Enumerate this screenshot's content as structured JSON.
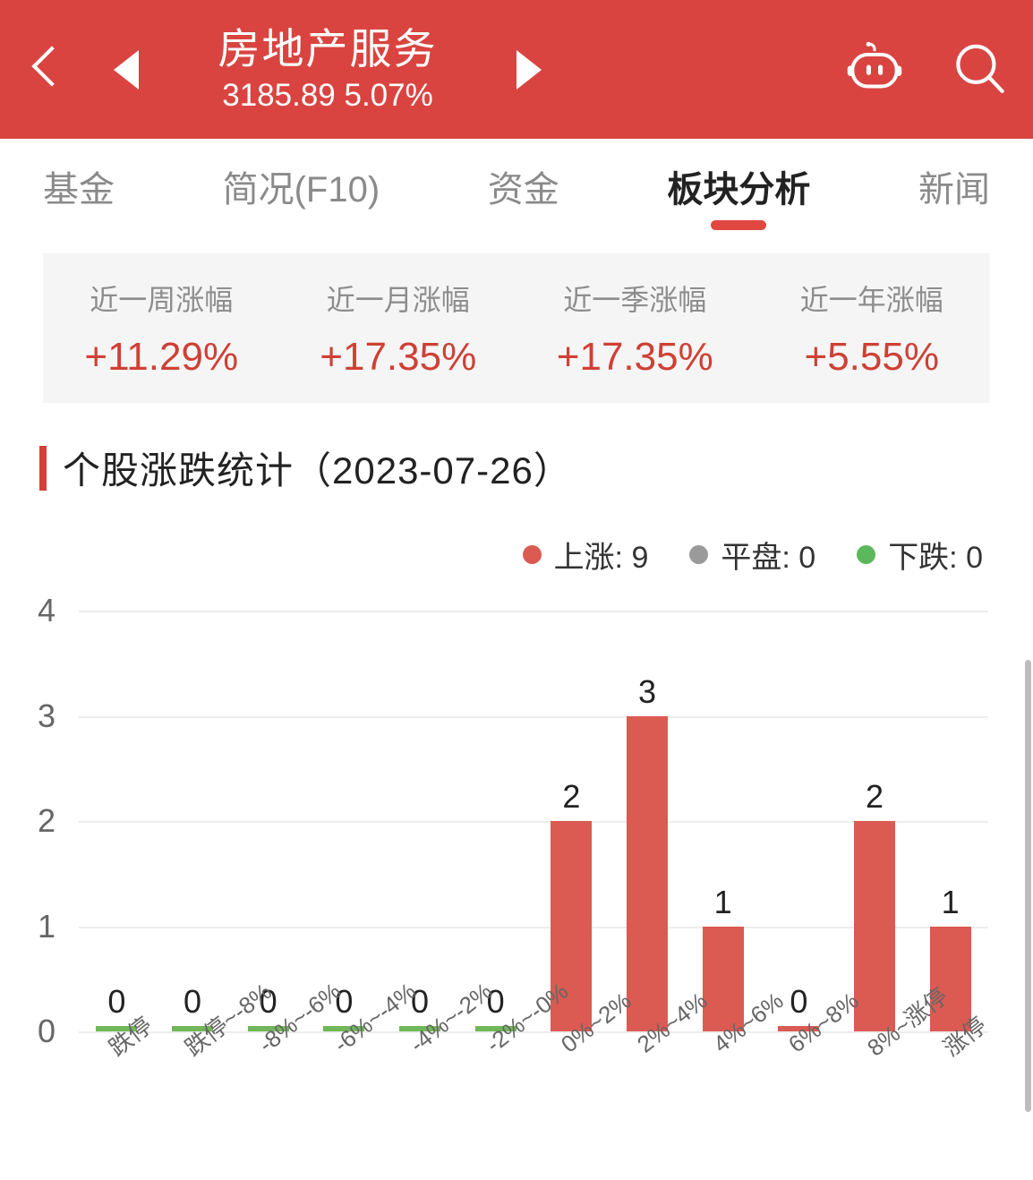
{
  "header": {
    "back_icon": "chevron-left-icon",
    "prev_icon": "triangle-left-icon",
    "next_icon": "triangle-right-icon",
    "robot_icon": "robot-assistant-icon",
    "search_icon": "search-icon",
    "title": "房地产服务",
    "subtitle": "3185.89 5.07%",
    "bg_color": "#d94440"
  },
  "tabs": [
    {
      "label": "基金",
      "active": false
    },
    {
      "label": "简况(F10)",
      "active": false
    },
    {
      "label": "资金",
      "active": false
    },
    {
      "label": "板块分析",
      "active": true
    },
    {
      "label": "新闻",
      "active": false
    }
  ],
  "stats": [
    {
      "label": "近一周涨幅",
      "value": "+11.29%"
    },
    {
      "label": "近一月涨幅",
      "value": "+17.35%"
    },
    {
      "label": "近一季涨幅",
      "value": "+17.35%"
    },
    {
      "label": "近一年涨幅",
      "value": "+5.55%"
    }
  ],
  "section": {
    "title": "个股涨跌统计（2023-07-26）"
  },
  "legend": [
    {
      "label": "上涨: 9",
      "color": "#db5a52"
    },
    {
      "label": "平盘: 0",
      "color": "#9a9a9a"
    },
    {
      "label": "下跌: 0",
      "color": "#5cb85c"
    }
  ],
  "colors": {
    "up": "#db5a52",
    "flat": "#9a9a9a",
    "down": "#72b65a",
    "accent": "#d43f3a",
    "panel": "#f5f5f5"
  },
  "chart_data": {
    "type": "bar",
    "title": "个股涨跌统计（2023-07-26）",
    "xlabel": "",
    "ylabel": "",
    "ylim": [
      0,
      4
    ],
    "yticks": [
      0,
      1,
      2,
      3,
      4
    ],
    "grid": true,
    "legend_position": "top-right",
    "categories": [
      "跌停",
      "跌停~-8%",
      "-8%~-6%",
      "-6%~-4%",
      "-4%~-2%",
      "-2%~-0%",
      "0%~2%",
      "2%~4%",
      "4%~6%",
      "6%~8%",
      "8%~涨停",
      "涨停"
    ],
    "values": [
      0,
      0,
      0,
      0,
      0,
      0,
      2,
      3,
      1,
      0,
      2,
      1
    ],
    "bar_colors": [
      "#72b65a",
      "#72b65a",
      "#72b65a",
      "#72b65a",
      "#72b65a",
      "#72b65a",
      "#db5a52",
      "#db5a52",
      "#db5a52",
      "#db5a52",
      "#db5a52",
      "#db5a52"
    ],
    "data_labels": [
      "0",
      "0",
      "0",
      "0",
      "0",
      "0",
      "2",
      "3",
      "1",
      "0",
      "2",
      "1"
    ],
    "legend": [
      {
        "name": "上涨",
        "value": 9,
        "color": "#db5a52"
      },
      {
        "name": "平盘",
        "value": 0,
        "color": "#9a9a9a"
      },
      {
        "name": "下跌",
        "value": 0,
        "color": "#5cb85c"
      }
    ]
  }
}
